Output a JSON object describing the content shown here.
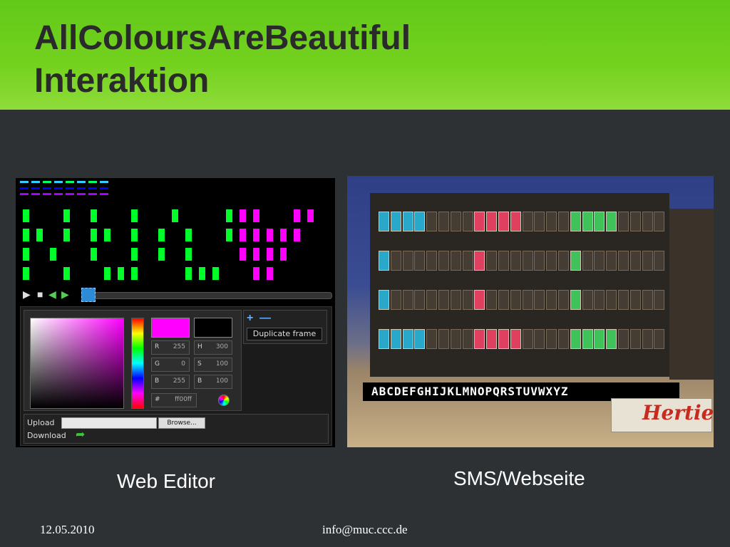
{
  "slide": {
    "title_line1": "AllColoursAreBeautiful",
    "title_line2": "Interaktion",
    "caption_left": "Web Editor",
    "caption_right": "SMS/Webseite",
    "footer_date": "12.05.2010",
    "footer_email": "info@muc.ccc.de"
  },
  "editor": {
    "duplicate_frame_label": "Duplicate frame",
    "upload_label": "Upload",
    "download_label": "Download",
    "browse_label": "Browse...",
    "fields": [
      {
        "label": "R",
        "value": "255"
      },
      {
        "label": "H",
        "value": "300"
      },
      {
        "label": "G",
        "value": "0"
      },
      {
        "label": "S",
        "value": "100"
      },
      {
        "label": "B",
        "value": "255"
      },
      {
        "label": "B",
        "value": "100"
      }
    ],
    "hex_label": "#",
    "hex_value": "ff00ff",
    "selected_color": "#ff00ff",
    "accent_green": "#00ff2a",
    "accent_magenta": "#ff00ff"
  },
  "photo": {
    "sign_text": "ABCDEFGHIJKLMNOPQRSTUVWXYZ",
    "store_logo": "Hertie"
  }
}
